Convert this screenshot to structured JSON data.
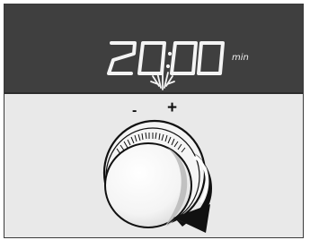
{
  "display": {
    "time_value": "20:00",
    "unit_label": "min",
    "active_digit_index": 2
  },
  "controls": {
    "minus_label": "-",
    "plus_label": "+",
    "rotation_direction": "clockwise"
  },
  "colors": {
    "display_background": "#3f3f3f",
    "segment_color": "#f4f4f4",
    "panel_background": "#e9e9e9",
    "knob_face": "#f7f7f7",
    "knob_shadow": "#bdbdbd",
    "arrow_color": "#111111"
  },
  "icons": {
    "cooking_indicator": "sparkle-icon",
    "rotate_indicator": "rotate-arrow-icon",
    "control": "rotary-knob-icon"
  }
}
